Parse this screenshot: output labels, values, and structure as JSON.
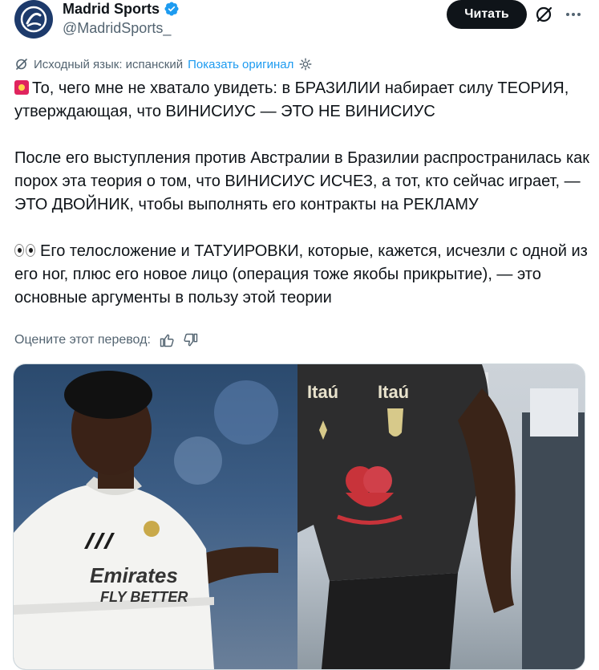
{
  "account": {
    "display_name": "Madrid Sports",
    "handle": "@MadridSports_",
    "verified": true,
    "avatar_color": "#1d3a6b"
  },
  "actions": {
    "follow_label": "Читать",
    "grok_icon": "grok-icon",
    "more_icon": "more-horizontal-icon"
  },
  "translation": {
    "source_language": "Исходный язык: испанский",
    "show_original": "Показать оригинал",
    "rate_label": "Оцените этот перевод:"
  },
  "tweet": {
    "paragraph_1": "То, чего мне не хватало увидеть: в БРАЗИЛИИ набирает силу ТЕОРИЯ, утверждающая, что ВИНИСИУС — ЭТО НЕ ВИНИСИУС",
    "paragraph_2": "После его выступления против Австралии в Бразилии распространилась как порох эта теория о том, что ВИНИСИУС ИСЧЕЗ, а тот, кто сейчас играет, — ЭТО ДВОЙНИК, чтобы выполнять его контракты на РЕКЛАМУ",
    "paragraph_3": "Его телосложение и ТАТУИРОВКИ, которые, кажется, исчезли с одной из его ног, плюс его новое лицо (операция тоже якобы прикрытие), — это основные аргументы в пользу этой теории"
  },
  "media": {
    "left_shirt_sponsor_1": "Emirates",
    "left_shirt_sponsor_2": "FLY BETTER",
    "right_shirt_sponsor": "Itaú"
  },
  "colors": {
    "link": "#1d9bf0",
    "secondary_text": "#536471",
    "primary_text": "#0f1419",
    "verified_badge": "#1d9bf0"
  }
}
